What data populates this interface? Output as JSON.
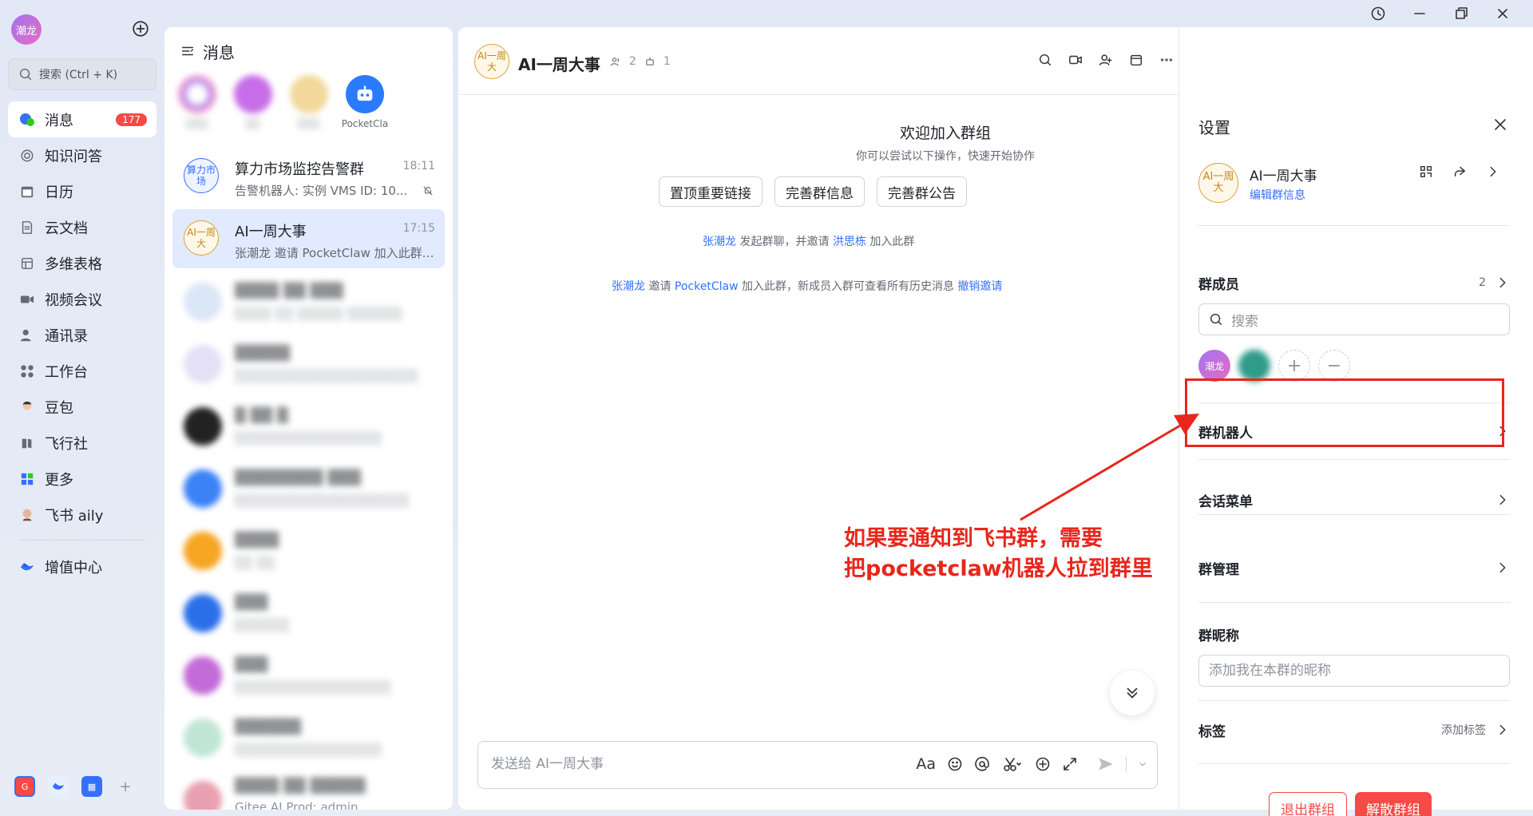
{
  "window": {
    "icons": [
      "history-icon",
      "minimize-icon",
      "restore-icon",
      "close-icon"
    ]
  },
  "nav": {
    "avatar": "潮龙",
    "search_placeholder": "搜索 (Ctrl + K)",
    "items": [
      {
        "label": "消息",
        "badge": "177"
      },
      {
        "label": "知识问答"
      },
      {
        "label": "日历"
      },
      {
        "label": "云文档"
      },
      {
        "label": "多维表格"
      },
      {
        "label": "视频会议"
      },
      {
        "label": "通讯录"
      },
      {
        "label": "工作台"
      },
      {
        "label": "豆包"
      },
      {
        "label": "飞行社"
      },
      {
        "label": "更多"
      },
      {
        "label": "飞书 aily"
      }
    ],
    "extra": "增值中心"
  },
  "chatlist": {
    "title": "消息",
    "stories": [
      "",
      "",
      "",
      "PocketCla"
    ],
    "chats": [
      {
        "name": "算力市场监控告警群",
        "time": "18:11",
        "preview": "告警机器人: 实例 VMS ID: 10...",
        "avatar": "算力市场"
      },
      {
        "name": "AI一周大事",
        "time": "17:15",
        "preview": "张潮龙 邀请 PocketClaw 加入此群，...",
        "avatar": "AI一周大"
      },
      {
        "name": "",
        "time": "",
        "preview": ""
      },
      {
        "name": "",
        "time": "",
        "preview": ""
      },
      {
        "name": "",
        "time": "",
        "preview": ""
      },
      {
        "name": "",
        "time": "",
        "preview": ""
      },
      {
        "name": "",
        "time": "",
        "preview": ""
      },
      {
        "name": "",
        "time": "",
        "preview": ""
      },
      {
        "name": "",
        "time": "",
        "preview": ""
      },
      {
        "name": "",
        "time": "",
        "preview": ""
      },
      {
        "name": "",
        "time": "",
        "preview": "Gitee AI Prod: admin"
      }
    ]
  },
  "chat": {
    "avatar": "AI一周大",
    "title": "AI一周大事",
    "members": "2",
    "bots": "1",
    "welcome_title": "欢迎加入群组",
    "welcome_sub": "你可以尝试以下操作，快速开始协作",
    "buttons": [
      "置顶重要链接",
      "完善群信息",
      "完善群公告"
    ],
    "sys1": {
      "user": "张潮龙",
      "mid": " 发起群聊，并邀请 ",
      "invitee": "洪思栋",
      "end": " 加入此群"
    },
    "sys2": {
      "user": "张潮龙",
      "mid": " 邀请 ",
      "bot": "PocketClaw",
      "end": " 加入此群，新成员入群可查看所有历史消息 ",
      "revoke": "撤销邀请"
    },
    "composer_placeholder": "发送给 AI一周大事"
  },
  "settings": {
    "title": "设置",
    "group_avatar": "AI一周大",
    "group_name": "AI一周大事",
    "edit_link": "编辑群信息",
    "members_label": "群成员",
    "members_count": "2",
    "search_placeholder": "搜索",
    "member_avatar": "潮龙",
    "bot_label": "群机器人",
    "menu_label": "会话菜单",
    "manage_label": "群管理",
    "nickname_label": "群昵称",
    "nickname_placeholder": "添加我在本群的昵称",
    "tags_label": "标签",
    "tags_add": "添加标签",
    "leave": "退出群组",
    "dissolve": "解散群组"
  },
  "annotation": {
    "text": "如果要通知到飞书群，需要\n把pocketclaw机器人拉到群里",
    "color": "#e8261c"
  },
  "colors": {
    "accent": "#3370ff",
    "danger": "#f54a45",
    "badge": "#f54a45"
  }
}
